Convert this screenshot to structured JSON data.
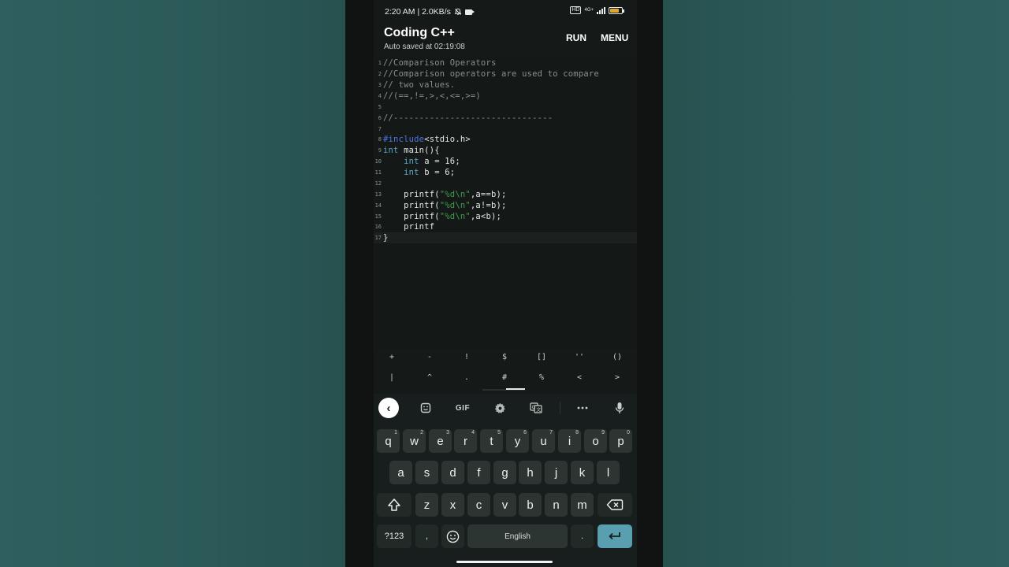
{
  "status_bar": {
    "time_speed": "2:20 AM | 2.0KB/s",
    "network_badge": "4G+",
    "hd_badge": "HD",
    "battery": "80"
  },
  "app_bar": {
    "title": "Coding C++",
    "subtitle": "Auto saved at 02:19:08",
    "run_label": "RUN",
    "menu_label": "MENU"
  },
  "editor": {
    "lines": [
      {
        "n": "1",
        "text": "//Comparison Operators"
      },
      {
        "n": "2",
        "text": "//Comparison operators are used to compare"
      },
      {
        "n": "3",
        "text": "// two values."
      },
      {
        "n": "4",
        "text": "//(==,!=,>,<,<=,>=)"
      },
      {
        "n": "5",
        "text": ""
      },
      {
        "n": "6",
        "text": "//-------------------------------"
      },
      {
        "n": "7",
        "text": ""
      },
      {
        "n": "8",
        "pre": "#include",
        "rest": "<stdio.h>"
      },
      {
        "n": "9",
        "kw": "int",
        "rest": " main(){"
      },
      {
        "n": "10",
        "indent": "    ",
        "kw": "int",
        "rest": " a = 16;"
      },
      {
        "n": "11",
        "indent": "    ",
        "kw": "int",
        "rest": " b = 6;"
      },
      {
        "n": "12",
        "text": ""
      },
      {
        "n": "13",
        "indent": "    printf(",
        "str": "\"%d\\n\"",
        "rest": ",a==b);"
      },
      {
        "n": "14",
        "indent": "    printf(",
        "str": "\"%d\\n\"",
        "rest": ",a!=b);"
      },
      {
        "n": "15",
        "indent": "    printf(",
        "str": "\"%d\\n\"",
        "rest": ",a<b);"
      },
      {
        "n": "16",
        "text": "    printf"
      },
      {
        "n": "17",
        "text": "}"
      }
    ]
  },
  "symbol_bar": {
    "row1": [
      "+",
      "-",
      "!",
      "$",
      "[]",
      "''",
      "()"
    ],
    "row2": [
      "|",
      "^",
      ".",
      "#",
      "%",
      "<",
      ">"
    ]
  },
  "keyboard": {
    "toolbar": {
      "gif_label": "GIF",
      "icons": [
        "back-icon",
        "sticker-icon",
        "gif-icon",
        "settings-icon",
        "translate-icon",
        "more-icon",
        "mic-icon"
      ]
    },
    "row1": [
      {
        "k": "q",
        "s": "1"
      },
      {
        "k": "w",
        "s": "2"
      },
      {
        "k": "e",
        "s": "3"
      },
      {
        "k": "r",
        "s": "4"
      },
      {
        "k": "t",
        "s": "5"
      },
      {
        "k": "y",
        "s": "6"
      },
      {
        "k": "u",
        "s": "7"
      },
      {
        "k": "i",
        "s": "8"
      },
      {
        "k": "o",
        "s": "9"
      },
      {
        "k": "p",
        "s": "0"
      }
    ],
    "row2": [
      "a",
      "s",
      "d",
      "f",
      "g",
      "h",
      "j",
      "k",
      "l"
    ],
    "row3": [
      "z",
      "x",
      "c",
      "v",
      "b",
      "n",
      "m"
    ],
    "sym_key": "?123",
    "comma_key": ",",
    "space_label": "English",
    "period_key": ".",
    "enter_icon": "enter-icon",
    "colors": {
      "enter": "#5a9fb0",
      "key": "#2c3532",
      "accent_include": "#4d73e6",
      "string": "#3f9a4a",
      "keyword": "#5fa6c7"
    }
  }
}
